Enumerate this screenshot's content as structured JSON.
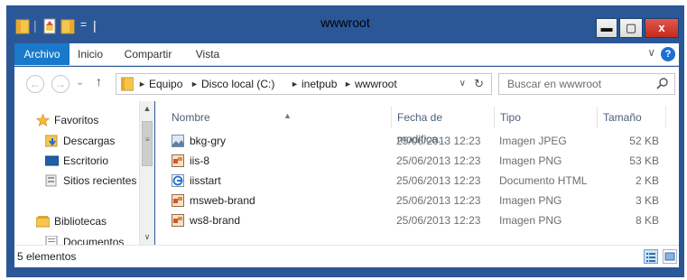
{
  "window": {
    "title": "wwwroot",
    "controls": {
      "minimize": "▬",
      "maximize": "▢",
      "close": "x"
    },
    "qat_separator": "|",
    "qat_dropdown": "="
  },
  "ribbon": {
    "tabs": [
      {
        "label": "Archivo",
        "active": true
      },
      {
        "label": "Inicio",
        "active": false
      },
      {
        "label": "Compartir",
        "active": false
      },
      {
        "label": "Vista",
        "active": false
      }
    ],
    "expand_glyph": "∨",
    "help_glyph": "?"
  },
  "nav": {
    "back": "←",
    "forward": "→",
    "recent": "⌄",
    "up": "↑",
    "breadcrumb": [
      "Equipo",
      "Disco local (C:)",
      "inetpub",
      "wwwroot"
    ],
    "separator": "►",
    "dropdown": "∨",
    "refresh": "↻"
  },
  "search": {
    "placeholder": "Buscar en wwwroot"
  },
  "sidebar": {
    "items": [
      {
        "label": "Favoritos",
        "icon": "star-icon"
      },
      {
        "label": "Descargas",
        "icon": "downloads-folder-icon"
      },
      {
        "label": "Escritorio",
        "icon": "desktop-icon"
      },
      {
        "label": "Sitios recientes",
        "icon": "recent-places-icon"
      },
      {
        "label": "Bibliotecas",
        "icon": "libraries-icon"
      },
      {
        "label": "Documentos",
        "icon": "documents-icon"
      }
    ],
    "scroll_up": "▲",
    "scroll_down": "∨",
    "scroll_grip": "≡"
  },
  "columns": {
    "name": "Nombre",
    "date": "Fecha de modifica...",
    "type": "Tipo",
    "size": "Tamaño",
    "sort_glyph": "▲"
  },
  "files": [
    {
      "name": "bkg-gry",
      "date": "25/06/2013 12:23",
      "type": "Imagen JPEG",
      "size": "52 KB",
      "icon": "jpeg-image-icon"
    },
    {
      "name": "iis-8",
      "date": "25/06/2013 12:23",
      "type": "Imagen PNG",
      "size": "53 KB",
      "icon": "png-image-icon"
    },
    {
      "name": "iisstart",
      "date": "25/06/2013 12:23",
      "type": "Documento HTML",
      "size": "2 KB",
      "icon": "html-document-icon"
    },
    {
      "name": "msweb-brand",
      "date": "25/06/2013 12:23",
      "type": "Imagen PNG",
      "size": "3 KB",
      "icon": "png-image-icon"
    },
    {
      "name": "ws8-brand",
      "date": "25/06/2013 12:23",
      "type": "Imagen PNG",
      "size": "8 KB",
      "icon": "png-image-icon"
    }
  ],
  "status": {
    "count": "5 elementos"
  },
  "colors": {
    "frame": "#2b5797",
    "accent": "#1979ca",
    "close": "#c42b1c"
  }
}
